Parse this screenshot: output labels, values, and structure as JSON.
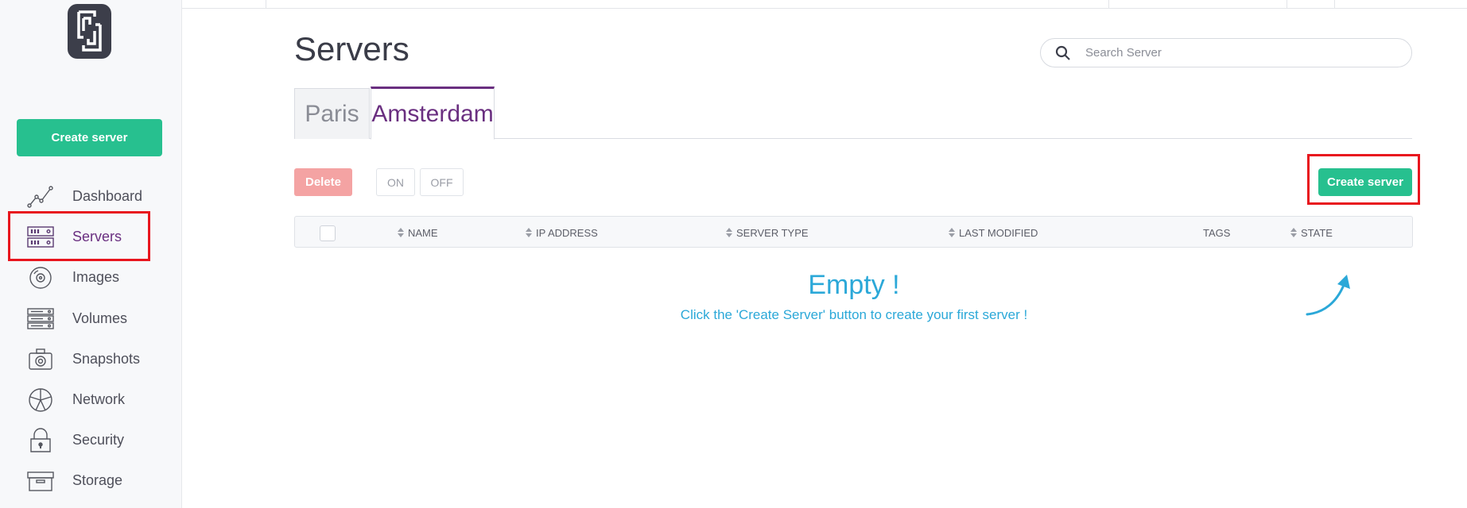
{
  "sidebar": {
    "logo_icon": "brand-logo-icon",
    "create_label": "Create server",
    "items": [
      {
        "label": "Dashboard",
        "icon": "chart-line-icon",
        "active": false
      },
      {
        "label": "Servers",
        "icon": "server-icon",
        "active": true
      },
      {
        "label": "Images",
        "icon": "disc-icon",
        "active": false
      },
      {
        "label": "Volumes",
        "icon": "volumes-icon",
        "active": false
      },
      {
        "label": "Snapshots",
        "icon": "camera-icon",
        "active": false
      },
      {
        "label": "Network",
        "icon": "network-icon",
        "active": false
      },
      {
        "label": "Security",
        "icon": "lock-icon",
        "active": false
      },
      {
        "label": "Storage",
        "icon": "box-icon",
        "active": false
      }
    ]
  },
  "main": {
    "title": "Servers",
    "search": {
      "placeholder": "Search Server",
      "value": ""
    },
    "tabs": [
      {
        "label": "Paris",
        "active": false
      },
      {
        "label": "Amsterdam",
        "active": true
      }
    ],
    "toolbar": {
      "delete_label": "Delete",
      "on_label": "ON",
      "off_label": "OFF",
      "create_label": "Create server"
    },
    "table": {
      "columns": [
        "NAME",
        "IP ADDRESS",
        "SERVER TYPE",
        "LAST MODIFIED",
        "TAGS",
        "STATE"
      ]
    },
    "empty": {
      "title": "Empty !",
      "message": "Click the 'Create Server' button to create your first server !"
    }
  },
  "colors": {
    "accent_green": "#27c08f",
    "brand_purple": "#6a2f80",
    "danger_light": "#f4a3a3",
    "info_blue": "#2ba8d8",
    "highlight_red": "#e8161e"
  }
}
